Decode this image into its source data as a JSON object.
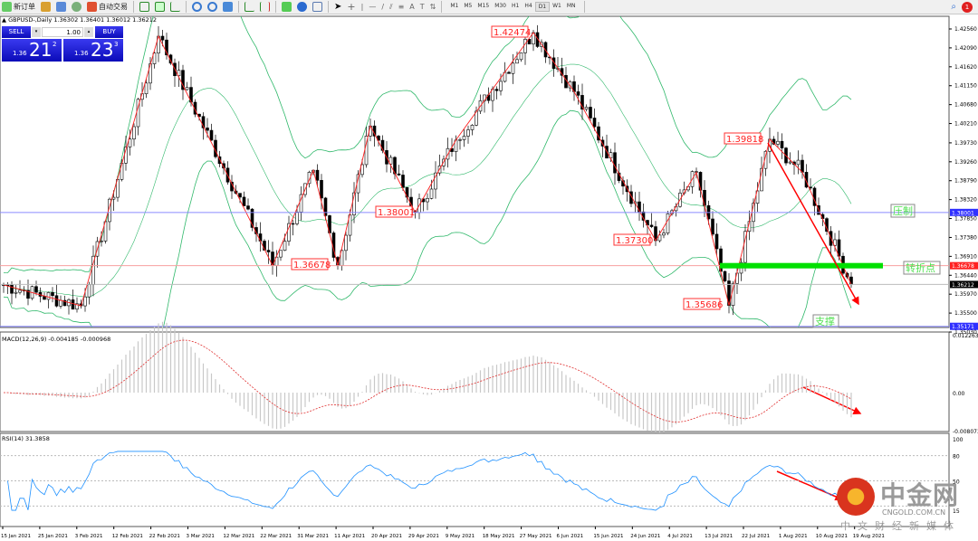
{
  "toolbar": {
    "new_order": "新订单",
    "auto_trading": "自动交易",
    "timeframes": [
      "M1",
      "M5",
      "M15",
      "M30",
      "H1",
      "H4",
      "D1",
      "W1",
      "MN"
    ],
    "active_timeframe": "D1",
    "notification_count": "1"
  },
  "chart_header": {
    "symbol": "GBPUSD-,Daily",
    "ohlc": "1.36302 1.36401 1.36012 1.36212"
  },
  "trade_panel": {
    "sell_label": "SELL",
    "buy_label": "BUY",
    "volume": "1.00",
    "sell_prefix": "1.36",
    "sell_big": "21",
    "sell_sup": "2",
    "buy_prefix": "1.36",
    "buy_big": "23",
    "buy_sup": "3"
  },
  "chart_data": {
    "type": "candlestick",
    "price_ticks": [
      "1.42560",
      "1.42090",
      "1.41620",
      "1.41150",
      "1.40680",
      "1.40210",
      "1.39730",
      "1.39260",
      "1.38790",
      "1.38320",
      "1.37850",
      "1.37380",
      "1.36910",
      "1.36440",
      "1.35970",
      "1.35500",
      "1.35030"
    ],
    "price_range": [
      1.3503,
      1.4256
    ],
    "date_ticks": [
      "15 Jan 2021",
      "25 Jan 2021",
      "3 Feb 2021",
      "12 Feb 2021",
      "22 Feb 2021",
      "3 Mar 2021",
      "12 Mar 2021",
      "22 Mar 2021",
      "31 Mar 2021",
      "11 Apr 2021",
      "20 Apr 2021",
      "29 Apr 2021",
      "9 May 2021",
      "18 May 2021",
      "27 May 2021",
      "6 Jun 2021",
      "15 Jun 2021",
      "24 Jun 2021",
      "4 Jul 2021",
      "13 Jul 2021",
      "22 Jul 2021",
      "1 Aug 2021",
      "10 Aug 2021",
      "19 Aug 2021"
    ],
    "pivots": [
      [
        0,
        1.362
      ],
      [
        19,
        1.3568
      ],
      [
        38,
        1.4238
      ],
      [
        66,
        1.3668
      ],
      [
        76,
        1.3905
      ],
      [
        82,
        1.3668
      ],
      [
        90,
        1.4015
      ],
      [
        101,
        1.38
      ],
      [
        111,
        1.398
      ],
      [
        130,
        1.4247
      ],
      [
        140,
        1.41
      ],
      [
        160,
        1.373
      ],
      [
        170,
        1.39
      ],
      [
        178,
        1.3569
      ],
      [
        188,
        1.3982
      ],
      [
        196,
        1.39
      ],
      [
        208,
        1.3621
      ]
    ],
    "pivot_labels": [
      {
        "text": "1.42474",
        "bar": 130,
        "price": 1.42474
      },
      {
        "text": "1.38001",
        "bar": 101,
        "price": 1.38001
      },
      {
        "text": "1.36678",
        "bar": 80,
        "price": 1.36678
      },
      {
        "text": "1.37300",
        "bar": 160,
        "price": 1.373
      },
      {
        "text": "1.39818",
        "bar": 188,
        "price": 1.39818
      },
      {
        "text": "1.35686",
        "bar": 178,
        "price": 1.35686
      }
    ],
    "hlines": [
      {
        "price": 1.38001,
        "label": "1.38001",
        "color": "#3030ff"
      },
      {
        "price": 1.36678,
        "label": "1.36678",
        "color": "#ff2020"
      },
      {
        "price": 1.36212,
        "label": "1.36212",
        "color": "#000000"
      },
      {
        "price": 1.35171,
        "label": "1.35171",
        "color": "#3030ff"
      }
    ],
    "annotations": {
      "resistance": "压制",
      "turning_point": "转折点",
      "support": "支撑"
    },
    "macd": {
      "title": "MACD(12,26,9) -0.004185 -0.000968",
      "ticks": [
        "0.012263",
        "0.00",
        "-0.008073"
      ]
    },
    "rsi": {
      "title": "RSI(14) 31.3858",
      "ticks": [
        "100",
        "80",
        "50",
        "15"
      ]
    }
  },
  "watermark": {
    "name": "中金网",
    "domain": "CNGOLD.COM.CN",
    "tagline": "中文财经新媒体"
  },
  "colors": {
    "bull": "#000000",
    "bear": "#000000",
    "zigzag": "#ff2020",
    "bands": "#2fb86a",
    "support_bar": "#00e000",
    "arrow": "#ff0000",
    "rsi": "#1e90ff"
  }
}
